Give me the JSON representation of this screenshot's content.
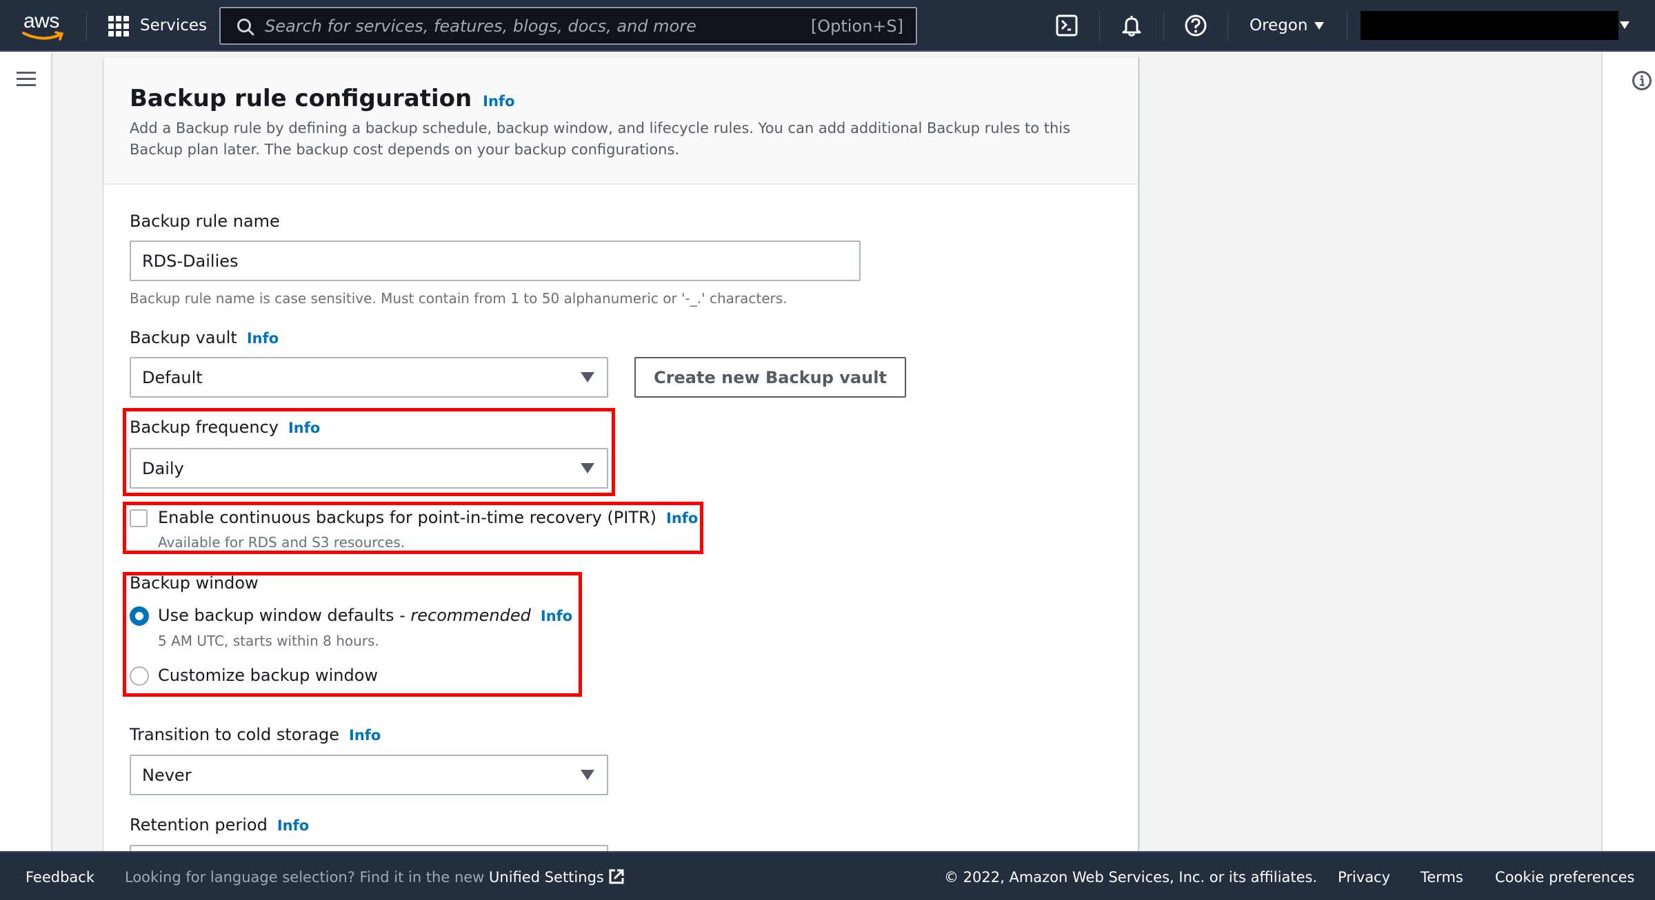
{
  "topnav": {
    "logo": "aws",
    "services_label": "Services",
    "search_placeholder": "Search for services, features, blogs, docs, and more",
    "search_shortcut": "[Option+S]",
    "icons": [
      "cloudshell-icon",
      "notifications-bell-icon",
      "help-icon"
    ],
    "region": "Oregon",
    "account": ""
  },
  "card": {
    "title": "Backup rule configuration",
    "title_info": "Info",
    "description": "Add a Backup rule by defining a backup schedule, backup window, and lifecycle rules. You can add additional Backup rules to this Backup plan later. The backup cost depends on your backup configurations.",
    "rule_name": {
      "label": "Backup rule name",
      "value": "RDS-Dailies",
      "hint": "Backup rule name is case sensitive. Must contain from 1 to 50 alphanumeric or '-_.' characters."
    },
    "vault": {
      "label": "Backup vault",
      "info": "Info",
      "selected": "Default",
      "create_button": "Create new Backup vault"
    },
    "frequency": {
      "label": "Backup frequency",
      "info": "Info",
      "selected": "Daily"
    },
    "pitr": {
      "label": "Enable continuous backups for point-in-time recovery (PITR)",
      "info": "Info",
      "description": "Available for RDS and S3 resources.",
      "checked": false
    },
    "window": {
      "label": "Backup window",
      "options": [
        {
          "label": "Use backup window defaults - ",
          "emphasis": "recommended",
          "info": "Info",
          "description": "5 AM UTC, starts within 8 hours.",
          "selected": true
        },
        {
          "label": "Customize backup window",
          "selected": false
        }
      ]
    },
    "cold_storage": {
      "label": "Transition to cold storage",
      "info": "Info",
      "selected": "Never"
    },
    "retention": {
      "label": "Retention period",
      "info": "Info"
    }
  },
  "footer": {
    "feedback": "Feedback",
    "language_text": "Looking for language selection? Find it in the new",
    "unified_settings": "Unified Settings",
    "copyright": "© 2022, Amazon Web Services, Inc. or its affiliates.",
    "links": [
      "Privacy",
      "Terms",
      "Cookie preferences"
    ]
  },
  "colors": {
    "nav_bg": "#232f3e",
    "link": "#0073bb",
    "highlight": "#ff0000"
  }
}
